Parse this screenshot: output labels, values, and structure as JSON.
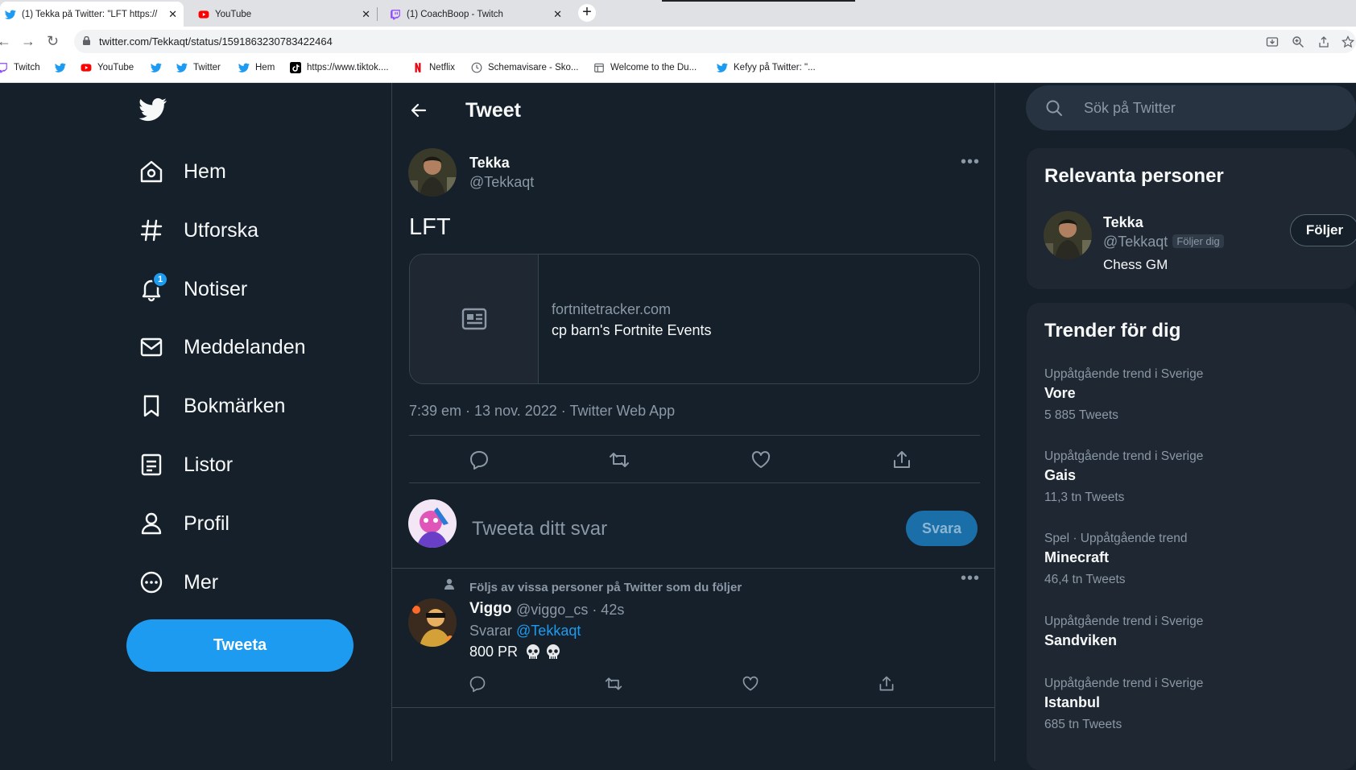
{
  "browser": {
    "tabs": [
      {
        "title": "(1) Tekka på Twitter: \"LFT https://",
        "icon": "twitter-icon"
      },
      {
        "title": "YouTube",
        "icon": "youtube-icon"
      },
      {
        "title": "(1) CoachBoop - Twitch",
        "icon": "twitch-icon"
      }
    ],
    "url": "twitter.com/Tekkaqt/status/1591863230783422464",
    "bookmarks": [
      {
        "label": "Twitch",
        "icon": "twitch-icon"
      },
      {
        "label": "",
        "icon": "twitter-icon"
      },
      {
        "label": "YouTube",
        "icon": "youtube-icon"
      },
      {
        "label": "",
        "icon": "twitter-icon"
      },
      {
        "label": "Twitter",
        "icon": "twitter-icon"
      },
      {
        "label": "Hem",
        "icon": "twitter-icon"
      },
      {
        "label": "https://www.tiktok....",
        "icon": "tiktok-icon"
      },
      {
        "label": "Netflix",
        "icon": "netflix-icon"
      },
      {
        "label": "Schemavisare - Sko...",
        "icon": "schedule-icon"
      },
      {
        "label": "Welcome to the Du...",
        "icon": "page-icon"
      },
      {
        "label": "Kefyy på Twitter: \"...",
        "icon": "twitter-icon"
      }
    ]
  },
  "nav": {
    "items": [
      {
        "label": "Hem",
        "icon": "home-icon"
      },
      {
        "label": "Utforska",
        "icon": "hashtag-icon"
      },
      {
        "label": "Notiser",
        "icon": "bell-icon",
        "badge": "1"
      },
      {
        "label": "Meddelanden",
        "icon": "envelope-icon"
      },
      {
        "label": "Bokmärken",
        "icon": "bookmark-icon"
      },
      {
        "label": "Listor",
        "icon": "list-icon"
      },
      {
        "label": "Profil",
        "icon": "person-icon"
      },
      {
        "label": "Mer",
        "icon": "more-circle-icon"
      }
    ],
    "tweet_button": "Tweeta"
  },
  "main": {
    "title": "Tweet",
    "tweet": {
      "author_name": "Tekka",
      "author_handle": "@Tekkaqt",
      "text": "LFT",
      "card": {
        "domain": "fortnitetracker.com",
        "title": "cp barn's Fortnite Events"
      },
      "meta": "7:39 em · 13 nov. 2022 · Twitter Web App"
    },
    "composer": {
      "placeholder": "Tweeta ditt svar",
      "button": "Svara"
    },
    "reply": {
      "social_context": "Följs av vissa personer på Twitter som du följer",
      "name": "Viggo",
      "handle_time": "@viggo_cs · 42s",
      "replying_label": "Svarar",
      "replying_to": "@Tekkaqt",
      "text": "800 PR"
    }
  },
  "sidebar": {
    "search_placeholder": "Sök på Twitter",
    "relevant": {
      "title": "Relevanta personer",
      "name": "Tekka",
      "handle": "@Tekkaqt",
      "follows_you": "Följer dig",
      "bio": "Chess GM",
      "button": "Följer"
    },
    "trends": {
      "title": "Trender för dig",
      "items": [
        {
          "context": "Uppåtgående trend i Sverige",
          "name": "Vore",
          "count": "5 885 Tweets"
        },
        {
          "context": "Uppåtgående trend i Sverige",
          "name": "Gais",
          "count": "11,3 tn Tweets"
        },
        {
          "context": "Spel · Uppåtgående trend",
          "name": "Minecraft",
          "count": "46,4 tn Tweets"
        },
        {
          "context": "Uppåtgående trend i Sverige",
          "name": "Sandviken",
          "count": ""
        },
        {
          "context": "Uppåtgående trend i Sverige",
          "name": "Istanbul",
          "count": "685 tn Tweets"
        }
      ]
    }
  },
  "colors": {
    "background": "#15202b",
    "accent": "#1d9bf0",
    "panel": "#1e2732",
    "border": "#38444d",
    "muted": "#8b98a5"
  }
}
